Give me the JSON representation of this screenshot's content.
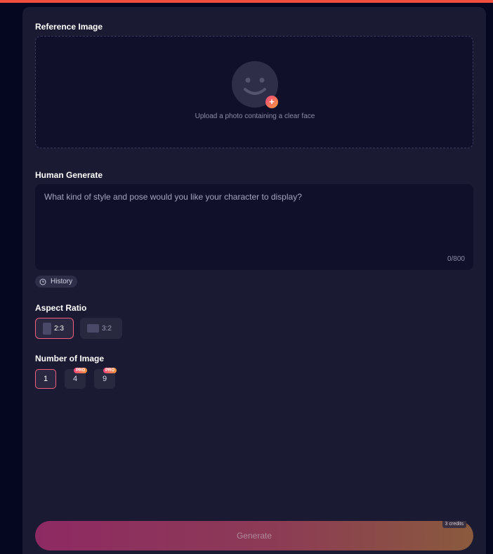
{
  "reference": {
    "title": "Reference Image",
    "upload_hint": "Upload a photo containing a clear face",
    "plus_glyph": "+"
  },
  "human_generate": {
    "title": "Human Generate",
    "placeholder": "What kind of style and pose would you like your character to display?",
    "char_count": "0/800",
    "history_label": "History"
  },
  "aspect_ratio": {
    "title": "Aspect Ratio",
    "options": [
      {
        "label": "2:3",
        "selected": true
      },
      {
        "label": "3:2",
        "selected": false
      }
    ]
  },
  "number_of_image": {
    "title": "Number of Image",
    "options": [
      {
        "label": "1",
        "selected": true,
        "pro": false
      },
      {
        "label": "4",
        "selected": false,
        "pro": true
      },
      {
        "label": "9",
        "selected": false,
        "pro": true
      }
    ],
    "pro_badge": "PRO"
  },
  "generate": {
    "label": "Generate",
    "credits": "3 credits"
  },
  "colors": {
    "background": "#050720",
    "panel": "#1a1a33",
    "accent_pink": "#f7457e",
    "accent_orange": "#f59a3b",
    "top_bar": "#f04e3e"
  }
}
